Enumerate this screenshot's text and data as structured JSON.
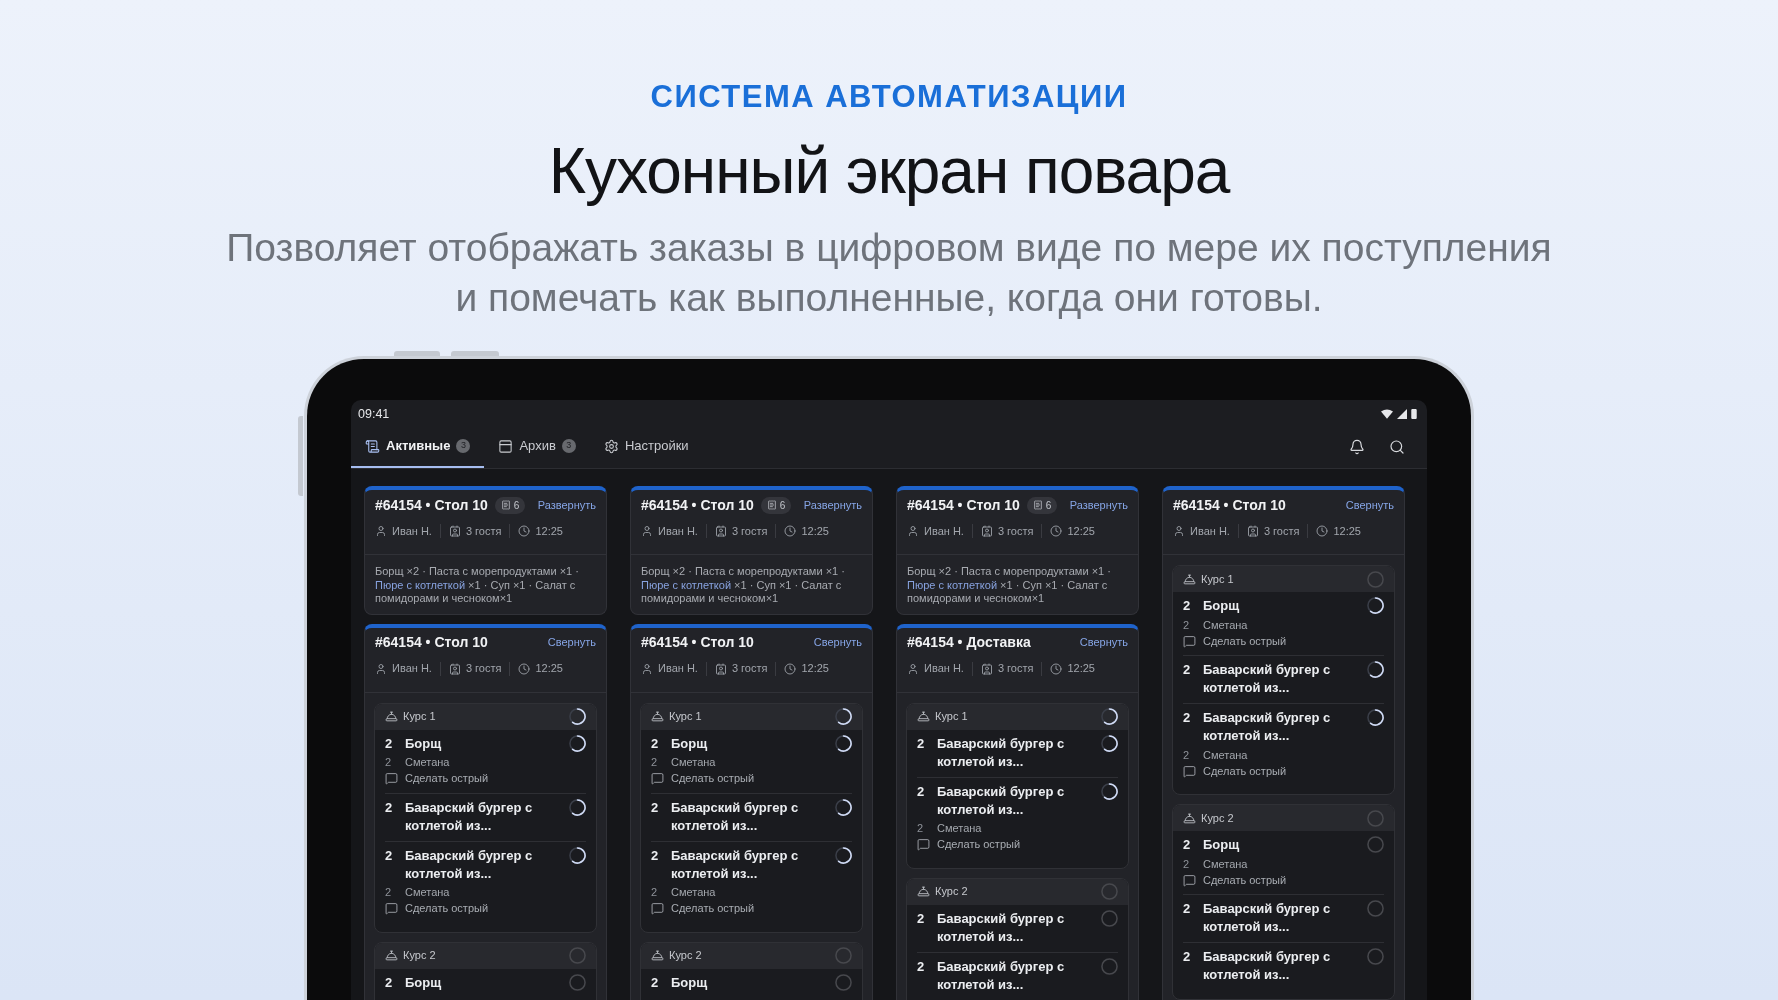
{
  "header": {
    "kicker": "СИСТЕМА АВТОМАТИЗАЦИИ",
    "title": "Кухонный экран повара",
    "subtitle": "Позволяет отображать заказы в цифровом виде по мере их поступления\nи помечать как выполненные, когда они готовы."
  },
  "status_bar": {
    "time": "09:41"
  },
  "tabs": [
    {
      "label": "Активные",
      "count": "3",
      "selected": true
    },
    {
      "label": "Архив",
      "count": "3",
      "selected": false
    },
    {
      "label": "Настройки",
      "selected": false
    }
  ],
  "columns": [
    {
      "orders": [
        {
          "title": "#64154 • Стол 10",
          "badge": "6",
          "toggle": "Развернуть",
          "expanded": false,
          "waiter": "Иван Н.",
          "guests": "3 гостя",
          "time": "12:25",
          "summary_separator": "·",
          "summary": [
            {
              "name": "Борщ",
              "qty": "×2",
              "highlighted": false
            },
            {
              "name": "Паста с морепродуктами",
              "qty": "×1",
              "highlighted": false
            },
            {
              "name": "Пюре с котлеткой",
              "qty": "×1",
              "highlighted": true
            },
            {
              "name": "Суп",
              "qty": "×1",
              "highlighted": false
            },
            {
              "name": "Салат с помидорами и чесноком×1",
              "highlighted": false
            }
          ]
        },
        {
          "title": "#64154 • Стол 10",
          "toggle": "Свернуть",
          "expanded": true,
          "waiter": "Иван Н.",
          "guests": "3 гостя",
          "time": "12:25",
          "courses": [
            {
              "name": "Курс 1",
              "started": true,
              "items": [
                {
                  "qty": "2",
                  "name": "Борщ",
                  "started": true,
                  "modifiers": [
                    {
                      "qty": "2",
                      "name": "Сметана"
                    }
                  ],
                  "comment": "Сделать острый"
                },
                {
                  "qty": "2",
                  "name": "Баварский бургер с котлетой из...",
                  "started": true
                },
                {
                  "qty": "2",
                  "name": "Баварский бургер с котлетой из...",
                  "started": true,
                  "modifiers": [
                    {
                      "qty": "2",
                      "name": "Сметана"
                    }
                  ],
                  "comment": "Сделать острый"
                }
              ]
            },
            {
              "name": "Курс 2",
              "started": false,
              "items": [
                {
                  "qty": "2",
                  "name": "Борщ",
                  "started": false
                }
              ]
            }
          ]
        }
      ]
    },
    {
      "orders": [
        {
          "title": "#64154 • Стол 10",
          "badge": "6",
          "toggle": "Развернуть",
          "expanded": false,
          "waiter": "Иван Н.",
          "guests": "3 гостя",
          "time": "12:25",
          "summary_separator": "·",
          "summary": [
            {
              "name": "Борщ",
              "qty": "×2",
              "highlighted": false
            },
            {
              "name": "Паста с морепродуктами",
              "qty": "×1",
              "highlighted": false
            },
            {
              "name": "Пюре с котлеткой",
              "qty": "×1",
              "highlighted": true
            },
            {
              "name": "Суп",
              "qty": "×1",
              "highlighted": false
            },
            {
              "name": "Салат с помидорами и чесноком×1",
              "highlighted": false
            }
          ]
        },
        {
          "title": "#64154 • Стол 10",
          "toggle": "Свернуть",
          "expanded": true,
          "waiter": "Иван Н.",
          "guests": "3 гостя",
          "time": "12:25",
          "courses": [
            {
              "name": "Курс 1",
              "started": true,
              "items": [
                {
                  "qty": "2",
                  "name": "Борщ",
                  "started": true,
                  "modifiers": [
                    {
                      "qty": "2",
                      "name": "Сметана"
                    }
                  ],
                  "comment": "Сделать острый"
                },
                {
                  "qty": "2",
                  "name": "Баварский бургер с котлетой из...",
                  "started": true
                },
                {
                  "qty": "2",
                  "name": "Баварский бургер с котлетой из...",
                  "started": true,
                  "modifiers": [
                    {
                      "qty": "2",
                      "name": "Сметана"
                    }
                  ],
                  "comment": "Сделать острый"
                }
              ]
            },
            {
              "name": "Курс 2",
              "started": false,
              "items": [
                {
                  "qty": "2",
                  "name": "Борщ",
                  "started": false
                }
              ]
            }
          ]
        }
      ]
    },
    {
      "orders": [
        {
          "title": "#64154 • Стол 10",
          "badge": "6",
          "toggle": "Развернуть",
          "expanded": false,
          "waiter": "Иван Н.",
          "guests": "3 гостя",
          "time": "12:25",
          "summary_separator": "·",
          "summary": [
            {
              "name": "Борщ",
              "qty": "×2",
              "highlighted": false
            },
            {
              "name": "Паста с морепродуктами",
              "qty": "×1",
              "highlighted": false
            },
            {
              "name": "Пюре с котлеткой",
              "qty": "×1",
              "highlighted": true
            },
            {
              "name": "Суп",
              "qty": "×1",
              "highlighted": false
            },
            {
              "name": "Салат с помидорами и чесноком×1",
              "highlighted": false
            }
          ]
        },
        {
          "title": "#64154 • Доставка",
          "toggle": "Свернуть",
          "expanded": true,
          "waiter": "Иван Н.",
          "guests": "3 гостя",
          "time": "12:25",
          "courses": [
            {
              "name": "Курс 1",
              "started": true,
              "items": [
                {
                  "qty": "2",
                  "name": "Баварский бургер с котлетой из...",
                  "started": true
                },
                {
                  "qty": "2",
                  "name": "Баварский бургер с котлетой из...",
                  "started": true,
                  "modifiers": [
                    {
                      "qty": "2",
                      "name": "Сметана"
                    }
                  ],
                  "comment": "Сделать острый"
                }
              ]
            },
            {
              "name": "Курс 2",
              "started": false,
              "items": [
                {
                  "qty": "2",
                  "name": "Баварский бургер с котлетой из...",
                  "started": false
                },
                {
                  "qty": "2",
                  "name": "Баварский бургер с котлетой из...",
                  "started": false
                }
              ]
            }
          ]
        }
      ]
    },
    {
      "orders": [
        {
          "title": "#64154 • Стол 10",
          "toggle": "Свернуть",
          "expanded": true,
          "waiter": "Иван Н.",
          "guests": "3 гостя",
          "time": "12:25",
          "courses": [
            {
              "name": "Курс 1",
              "started": false,
              "items": [
                {
                  "qty": "2",
                  "name": "Борщ",
                  "started": true,
                  "modifiers": [
                    {
                      "qty": "2",
                      "name": "Сметана"
                    }
                  ],
                  "comment": "Сделать острый"
                },
                {
                  "qty": "2",
                  "name": "Баварский бургер с котлетой из...",
                  "started": true
                },
                {
                  "qty": "2",
                  "name": "Баварский бургер с котлетой из...",
                  "started": true,
                  "modifiers": [
                    {
                      "qty": "2",
                      "name": "Сметана"
                    }
                  ],
                  "comment": "Сделать острый"
                }
              ]
            },
            {
              "name": "Курс 2",
              "started": false,
              "items": [
                {
                  "qty": "2",
                  "name": "Борщ",
                  "started": false,
                  "modifiers": [
                    {
                      "qty": "2",
                      "name": "Сметана"
                    }
                  ],
                  "comment": "Сделать острый"
                },
                {
                  "qty": "2",
                  "name": "Баварский бургер с котлетой из...",
                  "started": false
                },
                {
                  "qty": "2",
                  "name": "Баварский бургер с котлетой из...",
                  "started": false
                }
              ]
            }
          ]
        }
      ]
    }
  ]
}
